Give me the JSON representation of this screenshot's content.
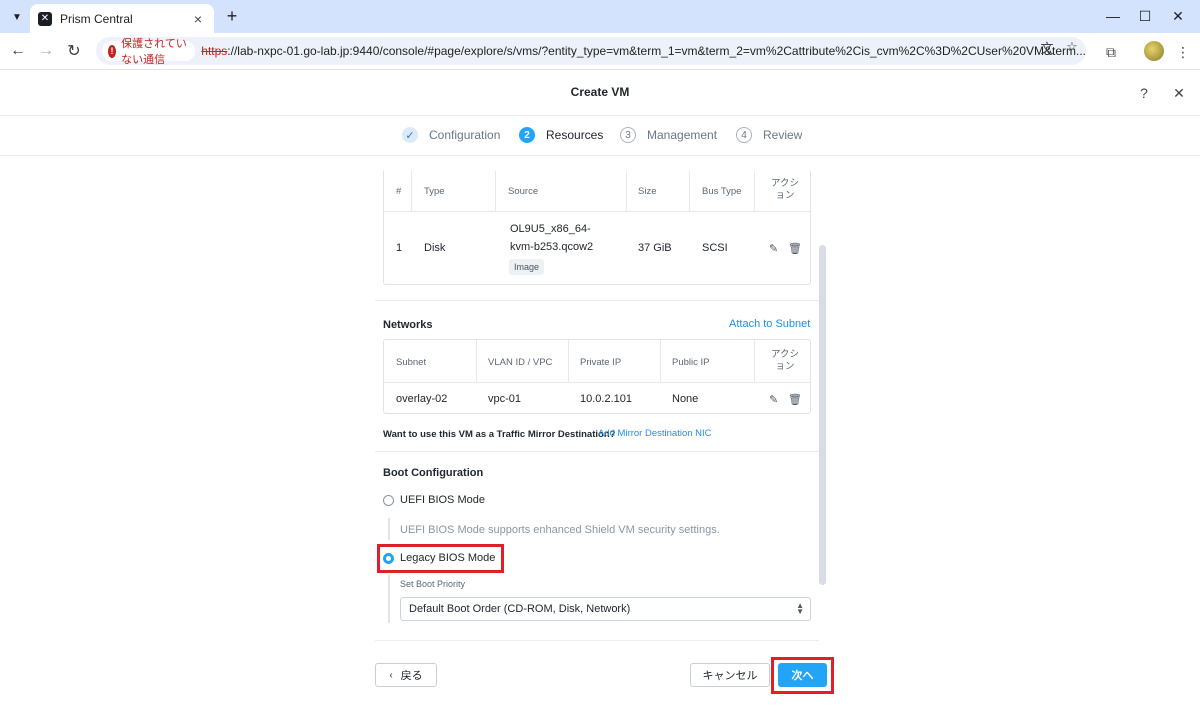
{
  "browser": {
    "tab_title": "Prism Central",
    "insecure_label": "保護されていない通信",
    "url_scheme": "https",
    "url_rest": "://lab-nxpc-01.go-lab.jp:9440/console/#page/explore/s/vms/?entity_type=vm&term_1=vm&term_2=vm%2Cattribute%2Cis_cvm%2C%3D%2CUser%20VM&term..."
  },
  "header": {
    "title": "Create VM",
    "help": "?",
    "close": "✕"
  },
  "steps": [
    {
      "num": "✓",
      "label": "Configuration",
      "state": "done"
    },
    {
      "num": "2",
      "label": "Resources",
      "state": "active"
    },
    {
      "num": "3",
      "label": "Management",
      "state": "todo"
    },
    {
      "num": "4",
      "label": "Review",
      "state": "todo"
    }
  ],
  "disks": {
    "headers": {
      "num": "#",
      "type": "Type",
      "source": "Source",
      "size": "Size",
      "bus": "Bus Type",
      "actions": "アクション"
    },
    "rows": [
      {
        "num": "1",
        "type": "Disk",
        "source_line1": "OL9U5_x86_64-",
        "source_line2": "kvm-b253.qcow2",
        "badge": "Image",
        "size": "37 GiB",
        "bus": "SCSI"
      }
    ]
  },
  "networks": {
    "title": "Networks",
    "attach_link": "Attach to Subnet",
    "headers": {
      "subnet": "Subnet",
      "vlan": "VLAN ID / VPC",
      "private_ip": "Private IP",
      "public_ip": "Public IP",
      "actions": "アクション"
    },
    "rows": [
      {
        "subnet": "overlay-02",
        "vlan": "vpc-01",
        "private_ip": "10.0.2.101",
        "public_ip": "None"
      }
    ],
    "mirror_question": "Want to use this VM as a Traffic Mirror Destination?",
    "mirror_link": "Add Mirror Destination NIC"
  },
  "boot": {
    "title": "Boot Configuration",
    "uefi_label": "UEFI BIOS Mode",
    "uefi_help": "UEFI BIOS Mode supports enhanced Shield VM security settings.",
    "legacy_label": "Legacy BIOS Mode",
    "selected": "legacy",
    "priority_label": "Set Boot Priority",
    "priority_value": "Default Boot Order (CD-ROM, Disk, Network)"
  },
  "footer": {
    "back": "戻る",
    "cancel": "キャンセル",
    "next": "次へ"
  },
  "colors": {
    "primary": "#22a5f7",
    "highlight": "#e11f26",
    "link": "#1f8fe0"
  }
}
